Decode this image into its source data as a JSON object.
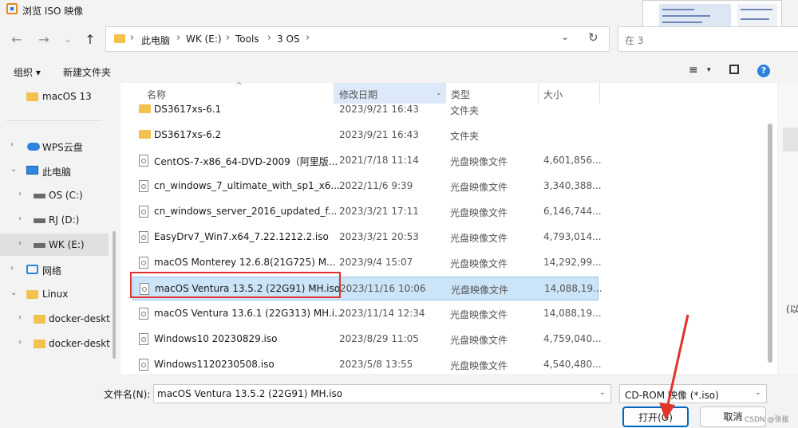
{
  "window": {
    "title": "浏览 ISO 映像"
  },
  "address": {
    "crumbs": [
      "此电脑",
      "WK (E:)",
      "Tools",
      "3 OS"
    ],
    "search_placeholder": "在 3"
  },
  "toolbar": {
    "organize": "组织 ▾",
    "new_folder": "新建文件夹"
  },
  "nav": {
    "items": [
      {
        "label": "macOS 13",
        "icon": "folder-icon"
      },
      {
        "label": "WPS云盘",
        "icon": "cloud-icon"
      },
      {
        "label": "此电脑",
        "icon": "computer-icon"
      },
      {
        "label": "OS (C:)",
        "icon": "drive-icon"
      },
      {
        "label": "RJ (D:)",
        "icon": "drive-icon"
      },
      {
        "label": "WK (E:)",
        "icon": "drive-icon"
      },
      {
        "label": "网络",
        "icon": "network-icon"
      },
      {
        "label": "Linux",
        "icon": "folder-icon"
      },
      {
        "label": "docker-deskt",
        "icon": "folder-icon"
      },
      {
        "label": "docker-deskt",
        "icon": "folder-icon"
      }
    ]
  },
  "columns": {
    "name": "名称",
    "date": "修改日期",
    "type": "类型",
    "size": "大小"
  },
  "files": [
    {
      "name": "DS3617xs-6.1",
      "date": "2023/9/21 16:43",
      "type": "文件夹",
      "size": "",
      "kind": "folder"
    },
    {
      "name": "DS3617xs-6.2",
      "date": "2023/9/21 16:43",
      "type": "文件夹",
      "size": "",
      "kind": "folder"
    },
    {
      "name": "CentOS-7-x86_64-DVD-2009（阿里版...",
      "date": "2021/7/18 11:14",
      "type": "光盘映像文件",
      "size": "4,601,856...",
      "kind": "iso"
    },
    {
      "name": "cn_windows_7_ultimate_with_sp1_x6...",
      "date": "2022/11/6 9:39",
      "type": "光盘映像文件",
      "size": "3,340,388...",
      "kind": "iso"
    },
    {
      "name": "cn_windows_server_2016_updated_f...",
      "date": "2023/3/21 17:11",
      "type": "光盘映像文件",
      "size": "6,146,744...",
      "kind": "iso"
    },
    {
      "name": "EasyDrv7_Win7.x64_7.22.1212.2.iso",
      "date": "2023/3/21 20:53",
      "type": "光盘映像文件",
      "size": "4,793,014...",
      "kind": "iso"
    },
    {
      "name": "macOS Monterey 12.6.8(21G725) M...",
      "date": "2023/9/4 15:07",
      "type": "光盘映像文件",
      "size": "14,292,99...",
      "kind": "iso"
    },
    {
      "name": "macOS Ventura 13.5.2 (22G91) MH.iso",
      "date": "2023/11/16 10:06",
      "type": "光盘映像文件",
      "size": "14,088,19...",
      "kind": "iso",
      "selected": true
    },
    {
      "name": "macOS Ventura 13.6.1 (22G313) MH.i...",
      "date": "2023/11/14 12:34",
      "type": "光盘映像文件",
      "size": "14,088,19...",
      "kind": "iso"
    },
    {
      "name": "Windows10 20230829.iso",
      "date": "2023/8/29 11:05",
      "type": "光盘映像文件",
      "size": "4,759,040...",
      "kind": "iso"
    },
    {
      "name": "Windows1120230508.iso",
      "date": "2023/5/8 13:55",
      "type": "光盘映像文件",
      "size": "4,540,480...",
      "kind": "iso"
    }
  ],
  "side_hint": "(以",
  "footer": {
    "filename_label": "文件名(N):",
    "filename_value": "macOS Ventura 13.5.2 (22G91) MH.iso",
    "filetype_value": "CD-ROM 映像 (*.iso)",
    "open_label": "打开(O)",
    "cancel_label": "取消",
    "watermark": "CSDN @张拔"
  },
  "colors": {
    "accent": "#0067c0",
    "selection": "#cce4f7",
    "annotation": "#e0332b"
  }
}
